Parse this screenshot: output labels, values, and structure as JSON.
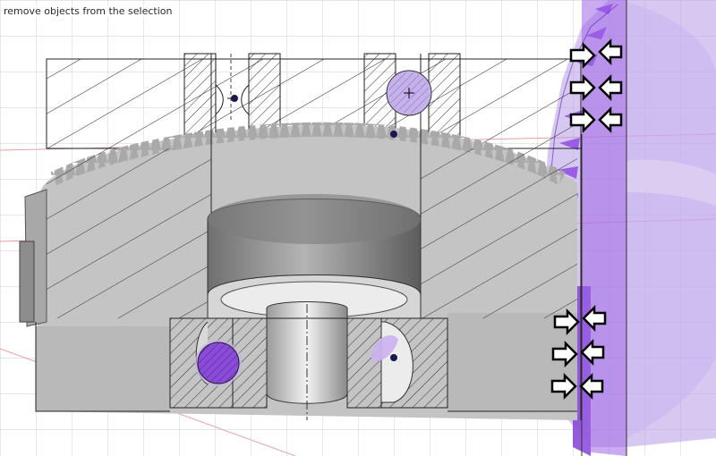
{
  "status_bar": {
    "hint_text": "remove objects from the selection"
  },
  "colors": {
    "selection_purple": "#8a4bd8",
    "part_gray": "#c8c8c8",
    "axis_red": "#e08080"
  },
  "scene": {
    "object": "gear-section-view",
    "arrow_markers": {
      "right_pointing_count": 6,
      "left_pointing_count": 6
    }
  }
}
